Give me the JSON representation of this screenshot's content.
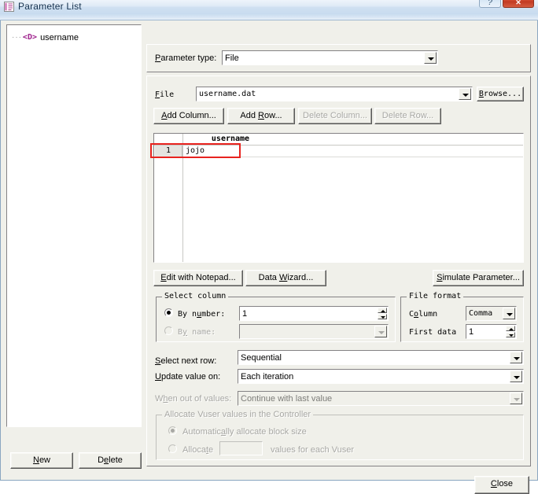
{
  "window": {
    "title": "Parameter List",
    "icon": "parameter-list-icon",
    "help_button": "?",
    "close_button": "✕"
  },
  "tree": {
    "items": [
      {
        "glyph": "<D>",
        "label": "username"
      }
    ]
  },
  "left_buttons": {
    "new": "New",
    "delete": "Delete"
  },
  "parameter_type": {
    "label": "Parameter type:",
    "value": "File"
  },
  "file_row": {
    "label": "File",
    "value": "username.dat",
    "browse": "Browse..."
  },
  "table_buttons": {
    "add_column": "Add Column...",
    "add_row": "Add Row...",
    "delete_column": "Delete Column...",
    "delete_row": "Delete Row..."
  },
  "grid": {
    "row_number_header": "",
    "columns": [
      "username"
    ],
    "rows": [
      {
        "number": "1",
        "values": [
          "jojo"
        ]
      }
    ],
    "highlight_color": "#e8231f"
  },
  "action_buttons": {
    "edit_with_notepad": "Edit with Notepad...",
    "data_wizard": "Data Wizard...",
    "simulate_parameter": "Simulate Parameter..."
  },
  "select_column": {
    "caption": "Select column",
    "by_number_label": "By number:",
    "by_number_value": "1",
    "by_number_selected": true,
    "by_name_label": "By name:",
    "by_name_value": "",
    "by_name_selected": false
  },
  "file_format": {
    "caption": "File format",
    "column_label": "Column",
    "column_value": "Comma",
    "first_data_label": "First data",
    "first_data_value": "1"
  },
  "row_options": {
    "select_next_row_label": "Select next row:",
    "select_next_row_value": "Sequential",
    "update_value_on_label": "Update value on:",
    "update_value_on_value": "Each iteration",
    "when_out_of_values_label": "When out of values:",
    "when_out_of_values_value": "Continue with last value"
  },
  "allocate": {
    "caption": "Allocate Vuser values in the Controller",
    "auto_label": "Automatically allocate block size",
    "auto_selected": true,
    "manual_label": "Allocate",
    "manual_suffix": "values for each Vuser",
    "manual_value": "",
    "manual_selected": false
  },
  "footer": {
    "close": "Close"
  }
}
